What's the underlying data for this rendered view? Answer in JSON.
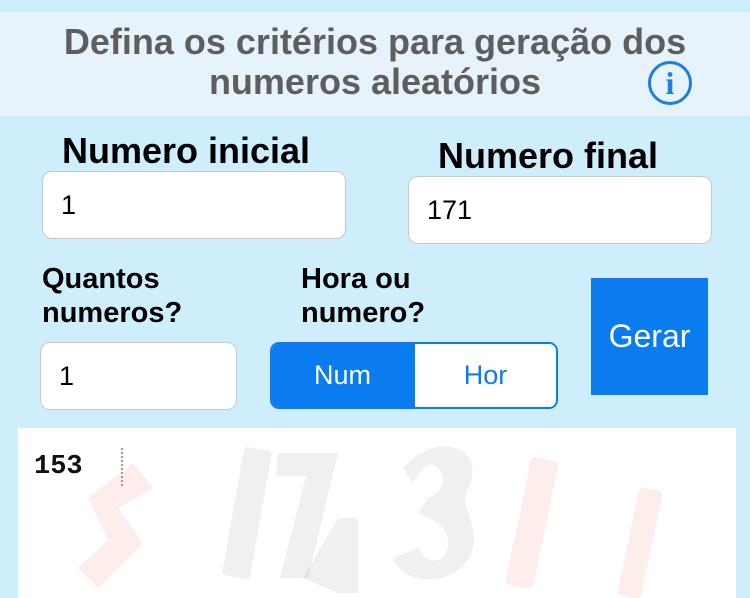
{
  "header": {
    "title_line1": "Defina os critérios para geração dos",
    "title_line2": "numeros aleatórios",
    "info_glyph": "i"
  },
  "numero_inicial": {
    "label": "Numero inicial",
    "value": "1"
  },
  "numero_final": {
    "label": "Numero final",
    "value": "171"
  },
  "quantos": {
    "label_line1": "Quantos",
    "label_line2": "numeros?",
    "value": "1"
  },
  "modo": {
    "label_line1": "Hora ou",
    "label_line2": "numero?",
    "options": [
      "Num",
      "Hor"
    ],
    "selected": "Num"
  },
  "gerar_label": "Gerar",
  "output": {
    "text": "153"
  },
  "colors": {
    "accent": "#0a7cf0",
    "background": "#cdeefa",
    "header": "#e6f3fa"
  }
}
